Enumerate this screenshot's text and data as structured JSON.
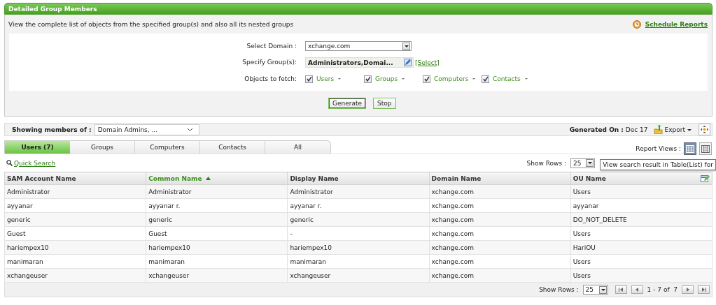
{
  "header": {
    "title": "Detailed Group Members"
  },
  "description": "View the complete list of objects from the specified group(s) and also all its nested groups",
  "schedule_link": "Schedule Reports",
  "form": {
    "domain_label": "Select Domain :",
    "domain_value": "xchange.com",
    "group_label": "Specify Group(s):",
    "group_value": "Administrators,Domai...",
    "select_link": "[Select]",
    "objects_label": "Objects to fetch:",
    "objects": [
      {
        "label": "Users",
        "checked": true
      },
      {
        "label": "Groups",
        "checked": true
      },
      {
        "label": "Computers",
        "checked": true
      },
      {
        "label": "Contacts",
        "checked": true
      }
    ],
    "buttons": [
      "Generate",
      "Stop"
    ]
  },
  "showing": {
    "label": "Showing members of :",
    "value": "Domain Admins, ..."
  },
  "generated": {
    "label": "Generated On :",
    "value": "Dec 17"
  },
  "export": "Export",
  "tabs": [
    {
      "label": "Users (7)",
      "selected": true
    },
    {
      "label": "Groups",
      "selected": false
    },
    {
      "label": "Computers",
      "selected": false
    },
    {
      "label": "Contacts",
      "selected": false
    },
    {
      "label": "All",
      "selected": false
    }
  ],
  "report_views_label": "Report Views :",
  "views": [
    {
      "kind": "table",
      "selected": true
    },
    {
      "kind": "list",
      "selected": false
    }
  ],
  "quick_search": "Quick Search",
  "show_rows": {
    "label": "Show Rows :",
    "value": "25"
  },
  "tooltip": "View search result in Table(List) for",
  "table": {
    "columns": [
      {
        "label": "SAM Account Name",
        "sorted": false
      },
      {
        "label": "Common Name",
        "sorted": true
      },
      {
        "label": "Display Name",
        "sorted": false
      },
      {
        "label": "Domain Name",
        "sorted": false
      },
      {
        "label": "OU Name",
        "sorted": false
      }
    ],
    "rows": [
      [
        "Administrator",
        "Administrator",
        "Administrator",
        "xchange.com",
        "Users"
      ],
      [
        "ayyanar",
        "ayyanar r.",
        "ayyanar r.",
        "xchange.com",
        "ayyanar"
      ],
      [
        "generic",
        "generic",
        "generic",
        "xchange.com",
        "DO_NOT_DELETE"
      ],
      [
        "Guest",
        "Guest",
        "-",
        "xchange.com",
        "Users"
      ],
      [
        "hariempex10",
        "hariempex10",
        "hariempex10",
        "xchange.com",
        "HariOU"
      ],
      [
        "manimaran",
        "manimaran",
        "manimaran",
        "xchange.com",
        "Users"
      ],
      [
        "xchangeuser",
        "xchangeuser",
        "xchangeuser",
        "xchange.com",
        "Users"
      ]
    ]
  },
  "footer": {
    "show_rows_label": "Show Rows :",
    "show_rows_value": "25",
    "page_info": "1 - 7 of  7"
  }
}
